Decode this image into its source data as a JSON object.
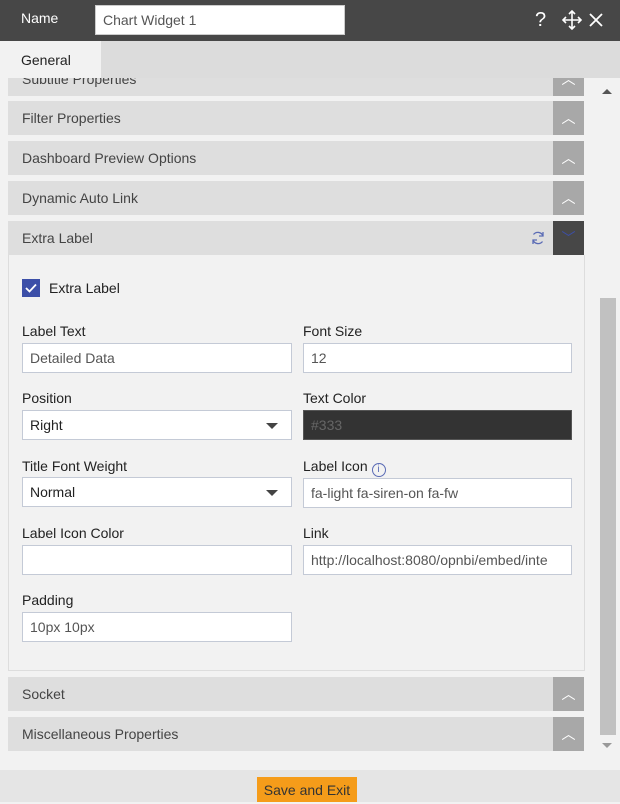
{
  "header": {
    "name_label": "Name",
    "name_value": "Chart Widget 1",
    "icons": [
      "question-icon",
      "move-icon",
      "close-icon"
    ]
  },
  "tabs": [
    {
      "label": "General",
      "active": true
    }
  ],
  "sections": [
    {
      "title": "Subtitle Properties",
      "expanded": false
    },
    {
      "title": "Filter Properties",
      "expanded": false
    },
    {
      "title": "Dashboard Preview Options",
      "expanded": false
    },
    {
      "title": "Dynamic Auto Link",
      "expanded": false
    },
    {
      "title": "Extra Label",
      "expanded": true
    },
    {
      "title": "Socket",
      "expanded": false
    },
    {
      "title": "Miscellaneous Properties",
      "expanded": false
    }
  ],
  "extra_label": {
    "checkbox_label": "Extra Label",
    "checked": true,
    "label_text": {
      "label": "Label Text",
      "value": "Detailed Data"
    },
    "font_size": {
      "label": "Font Size",
      "value": "12"
    },
    "position": {
      "label": "Position",
      "value": "Right"
    },
    "text_color": {
      "label": "Text Color",
      "value": "#333"
    },
    "title_font_weight": {
      "label": "Title Font Weight",
      "value": "Normal"
    },
    "label_icon": {
      "label": "Label Icon",
      "value": "fa-light fa-siren-on fa-fw"
    },
    "label_icon_color": {
      "label": "Label Icon Color",
      "value": ""
    },
    "link": {
      "label": "Link",
      "value": "http://localhost:8080/opnbi/embed/inte"
    },
    "padding": {
      "label": "Padding",
      "value": "10px 10px"
    }
  },
  "footer": {
    "save_label": "Save and Exit"
  },
  "colors": {
    "header": "#474747",
    "accent": "#f59c1a",
    "checkbox": "#3c4fa8"
  }
}
